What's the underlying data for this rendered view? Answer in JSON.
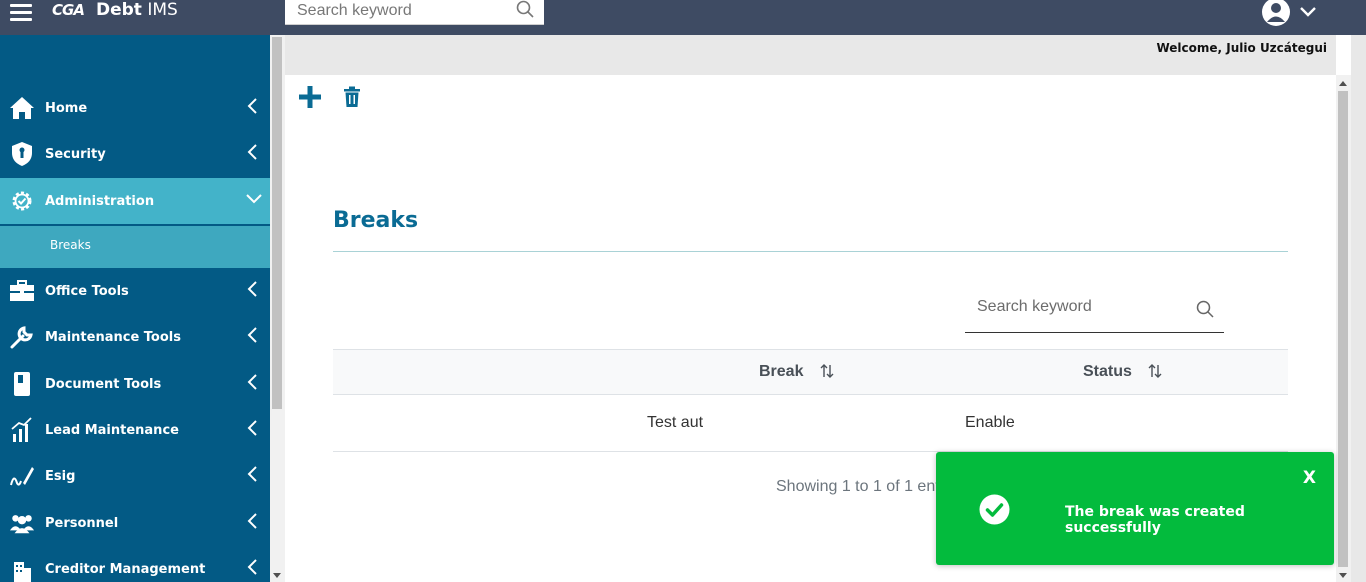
{
  "header": {
    "logo_text": "CGA",
    "app_title_bold": "Debt",
    "app_title_rest": "IMS",
    "search_placeholder": "Search keyword"
  },
  "welcome": "Welcome, Julio Uzcátegui",
  "sidebar": {
    "items": [
      {
        "label": "Home",
        "icon": "home-icon"
      },
      {
        "label": "Security",
        "icon": "shield-icon"
      },
      {
        "label": "Administration",
        "icon": "gear-icon",
        "expanded": true,
        "children": [
          {
            "label": "Breaks"
          }
        ]
      },
      {
        "label": "Office Tools",
        "icon": "briefcase-icon"
      },
      {
        "label": "Maintenance Tools",
        "icon": "wrench-icon"
      },
      {
        "label": "Document Tools",
        "icon": "book-icon"
      },
      {
        "label": "Lead Maintenance",
        "icon": "chart-icon"
      },
      {
        "label": "Esig",
        "icon": "signature-icon"
      },
      {
        "label": "Personnel",
        "icon": "users-icon"
      },
      {
        "label": "Creditor Management",
        "icon": "building-icon"
      }
    ]
  },
  "page": {
    "title": "Breaks",
    "table_search_placeholder": "Search keyword",
    "columns": [
      "Break",
      "Status"
    ],
    "rows": [
      {
        "break": "Test aut",
        "status": "Enable"
      }
    ],
    "footer": "Showing 1 to 1 of 1 entries"
  },
  "toast": {
    "message": "The break was created successfully",
    "close_label": "X",
    "color": "#03bb3d"
  },
  "colors": {
    "topbar": "#3e4b63",
    "sidebar": "#035a85",
    "active": "#43b3c9",
    "title": "#0a6b94"
  }
}
